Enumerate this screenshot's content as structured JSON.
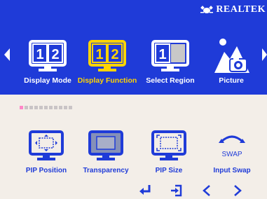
{
  "brand": {
    "logo_text": "REALTEK"
  },
  "top_menu": {
    "items": [
      {
        "label": "Display Mode",
        "panels": [
          "1",
          "2"
        ]
      },
      {
        "label": "Display Function",
        "panels": [
          "1",
          "2"
        ]
      },
      {
        "label": "Select Region",
        "panels": [
          "1"
        ]
      },
      {
        "label": "Picture"
      }
    ],
    "active_index": 1
  },
  "page_indicator": {
    "count": 11,
    "current": 0
  },
  "sub_menu": {
    "items": [
      {
        "label": "PIP Position",
        "icon": "pip-position-icon"
      },
      {
        "label": "Transparency",
        "icon": "transparency-icon"
      },
      {
        "label": "PIP Size",
        "icon": "pip-size-icon"
      },
      {
        "label": "Input Swap",
        "icon": "input-swap-icon",
        "icon_text": "SWAP"
      }
    ]
  },
  "nav": [
    "enter-icon",
    "exit-icon",
    "left-arrow-icon",
    "right-arrow-icon"
  ],
  "colors": {
    "blue": "#1f3bd8",
    "active_yellow": "#ffd400",
    "background": "#f3eee8"
  }
}
